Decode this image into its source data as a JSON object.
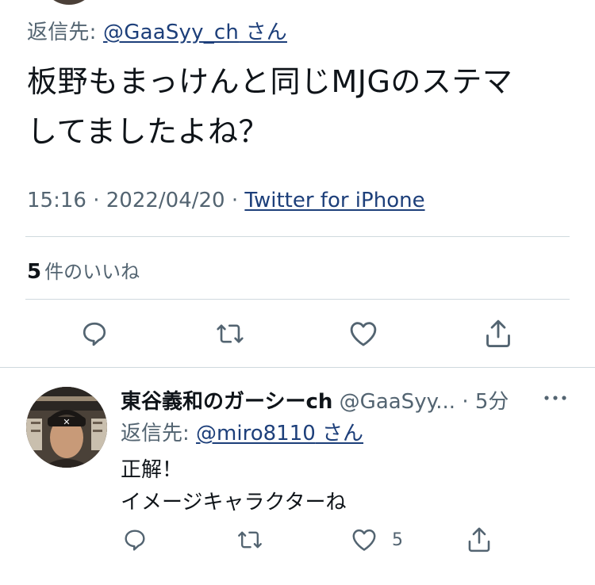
{
  "main_tweet": {
    "reply_prefix": "返信先: ",
    "reply_handle": "@GaaSyy_ch",
    "reply_suffix": " さん",
    "text_line1": "板野もまっけんと同じMJGのステマ",
    "text_line2": "してましたよね？",
    "time": "15:16",
    "date": "2022/04/20",
    "separator": " · ",
    "source": "Twitter for iPhone",
    "likes_count": "5",
    "likes_label": "件のいいね"
  },
  "reply_tweet": {
    "name": "東谷義和のガーシーch",
    "handle": "@GaaSyy...",
    "time": "5分",
    "reply_prefix": "返信先: ",
    "reply_handle": "@miro8110",
    "reply_suffix": " さん",
    "text": "正解！\nイメージキャラクターね",
    "like_count": "5"
  },
  "icons": {
    "reply": "reply-icon",
    "retweet": "retweet-icon",
    "like": "heart-icon",
    "share": "share-icon",
    "more": "more-icon"
  },
  "colors": {
    "text": "#0f1419",
    "secondary": "#536471",
    "link": "#1d3f7a",
    "divider": "#cfd9de"
  }
}
